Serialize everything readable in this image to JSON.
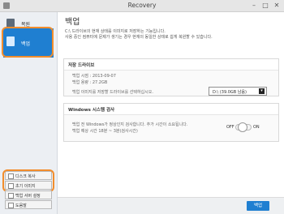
{
  "window": {
    "title": "Recovery"
  },
  "sidebar": {
    "items": [
      {
        "label": "복원"
      },
      {
        "label": "백업"
      }
    ],
    "buttons": [
      {
        "label": "디스크 복사"
      },
      {
        "label": "초기 이미지"
      },
      {
        "label": "백업 서버 설정"
      },
      {
        "label": "도움말"
      }
    ]
  },
  "main": {
    "title": "백업",
    "intro_line1": "C:\\ 드라이브의 현재 상태를 이미지로 저장하는 기능입니다.",
    "intro_line2": "사용 중인 컴퓨터에 문제가 생기는 경우 현재의 동일한 상태로 쉽게 복원할 수 있습니다.",
    "storage": {
      "heading": "저장 드라이브",
      "backup_time": "백업 시점 : 2013-09-07",
      "backup_size": "백업 용량 : 27.2GB",
      "instruction": "백업 이미지를 저장할 드라이브를 선택하십시오.",
      "drive_value": "D:\\ (39.0GB 남음)"
    },
    "windows_check": {
      "heading": "Windows 시스템 검사",
      "line1": "백업 전 Windows가 정상인지 검사합니다. 추가 시간이 소요됩니다.",
      "line2": "백업 예상 시간 18분 ~ 3분(검사시간)",
      "toggle_off": "OFF",
      "toggle_on": "ON",
      "toggle_state": "on"
    },
    "primary_button": "백업"
  }
}
